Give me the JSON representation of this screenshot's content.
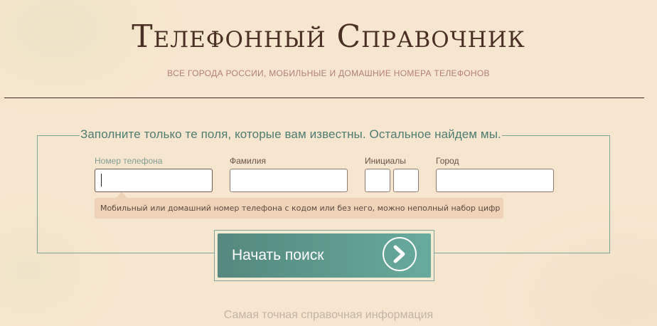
{
  "header": {
    "title": "Телефонный Справочник",
    "subtitle": "ВСЕ ГОРОДА РОССИИ, МОБИЛЬНЫЕ И ДОМАШНИЕ НОМЕРА ТЕЛЕФОНОВ"
  },
  "form": {
    "legend": "Заполните только те поля, которые вам известны. Остальное найдем мы.",
    "fields": {
      "phone": {
        "label": "Номер телефона",
        "value": ""
      },
      "surname": {
        "label": "Фамилия",
        "value": ""
      },
      "initials": {
        "label": "Инициалы",
        "first_value": "",
        "second_value": ""
      },
      "city": {
        "label": "Город",
        "value": ""
      }
    },
    "hint": "Мобильный или домашний номер телефона с кодом или без него, можно неполный набор цифр",
    "search_button": {
      "label": "Начать поиск",
      "icon": "chevron-right-icon"
    }
  },
  "footer": {
    "tagline": "Самая точная справочная информация"
  },
  "colors": {
    "background": "#f7e6cf",
    "accent": "#5f9c8f",
    "title": "#4a2f24"
  }
}
